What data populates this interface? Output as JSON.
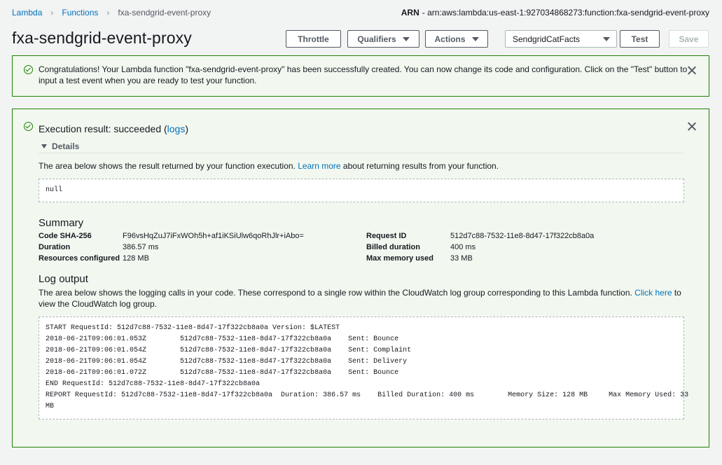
{
  "breadcrumb": {
    "items": [
      "Lambda",
      "Functions",
      "fxa-sendgrid-event-proxy"
    ]
  },
  "arn": {
    "label": "ARN",
    "value": "- arn:aws:lambda:us-east-1:927034868273:function:fxa-sendgrid-event-proxy"
  },
  "header": {
    "title": "fxa-sendgrid-event-proxy",
    "throttle_label": "Throttle",
    "qualifiers_label": "Qualifiers",
    "actions_label": "Actions",
    "test_event_selected": "SendgridCatFacts",
    "test_label": "Test",
    "save_label": "Save"
  },
  "flash": {
    "message": "Congratulations! Your Lambda function \"fxa-sendgrid-event-proxy\" has been successfully created. You can now change its code and configuration. Click on the \"Test\" button to input a test event when you are ready to test your function."
  },
  "execution": {
    "title_prefix": "Execution result: succeeded (",
    "logs_link": "logs",
    "title_suffix": ")",
    "details_label": "Details",
    "result_intro_prefix": "The area below shows the result returned by your function execution. ",
    "result_learn_more": "Learn more",
    "result_intro_suffix": " about returning results from your function.",
    "result_value": "null"
  },
  "summary": {
    "heading": "Summary",
    "left": [
      {
        "label": "Code SHA-256",
        "value": "F96vsHqZuJ7iFxWOh5h+af1iKSiUlw6qoRhJlr+iAbo="
      },
      {
        "label": "Duration",
        "value": "386.57 ms"
      },
      {
        "label": "Resources configured",
        "value": "128 MB"
      }
    ],
    "right": [
      {
        "label": "Request ID",
        "value": "512d7c88-7532-11e8-8d47-17f322cb8a0a"
      },
      {
        "label": "Billed duration",
        "value": "400 ms"
      },
      {
        "label": "Max memory used",
        "value": "33 MB"
      }
    ]
  },
  "log_output": {
    "heading": "Log output",
    "intro_prefix": "The area below shows the logging calls in your code. These correspond to a single row within the CloudWatch log group corresponding to this Lambda function. ",
    "click_here": "Click here",
    "intro_suffix": " to view the CloudWatch log group.",
    "lines": [
      "START RequestId: 512d7c88-7532-11e8-8d47-17f322cb8a0a Version: $LATEST",
      "2018-06-21T09:06:01.053Z\t512d7c88-7532-11e8-8d47-17f322cb8a0a\tSent: Bounce",
      "2018-06-21T09:06:01.054Z\t512d7c88-7532-11e8-8d47-17f322cb8a0a\tSent: Complaint",
      "2018-06-21T09:06:01.054Z\t512d7c88-7532-11e8-8d47-17f322cb8a0a\tSent: Delivery",
      "2018-06-21T09:06:01.072Z\t512d7c88-7532-11e8-8d47-17f322cb8a0a\tSent: Bounce",
      "END RequestId: 512d7c88-7532-11e8-8d47-17f322cb8a0a",
      "REPORT RequestId: 512d7c88-7532-11e8-8d47-17f322cb8a0a  Duration: 386.57 ms    Billed Duration: 400 ms        Memory Size: 128 MB     Max Memory Used: 33",
      "MB"
    ]
  },
  "icons": {
    "success": "check-circle-icon",
    "dismiss": "close-icon",
    "expand": "triangle-down-icon",
    "dropdown": "caret-down-icon"
  },
  "colors": {
    "link": "#0073bb",
    "success_border": "#1d8102",
    "success_bg": "#f2f8f0",
    "page_bg": "#f2f3f3"
  }
}
